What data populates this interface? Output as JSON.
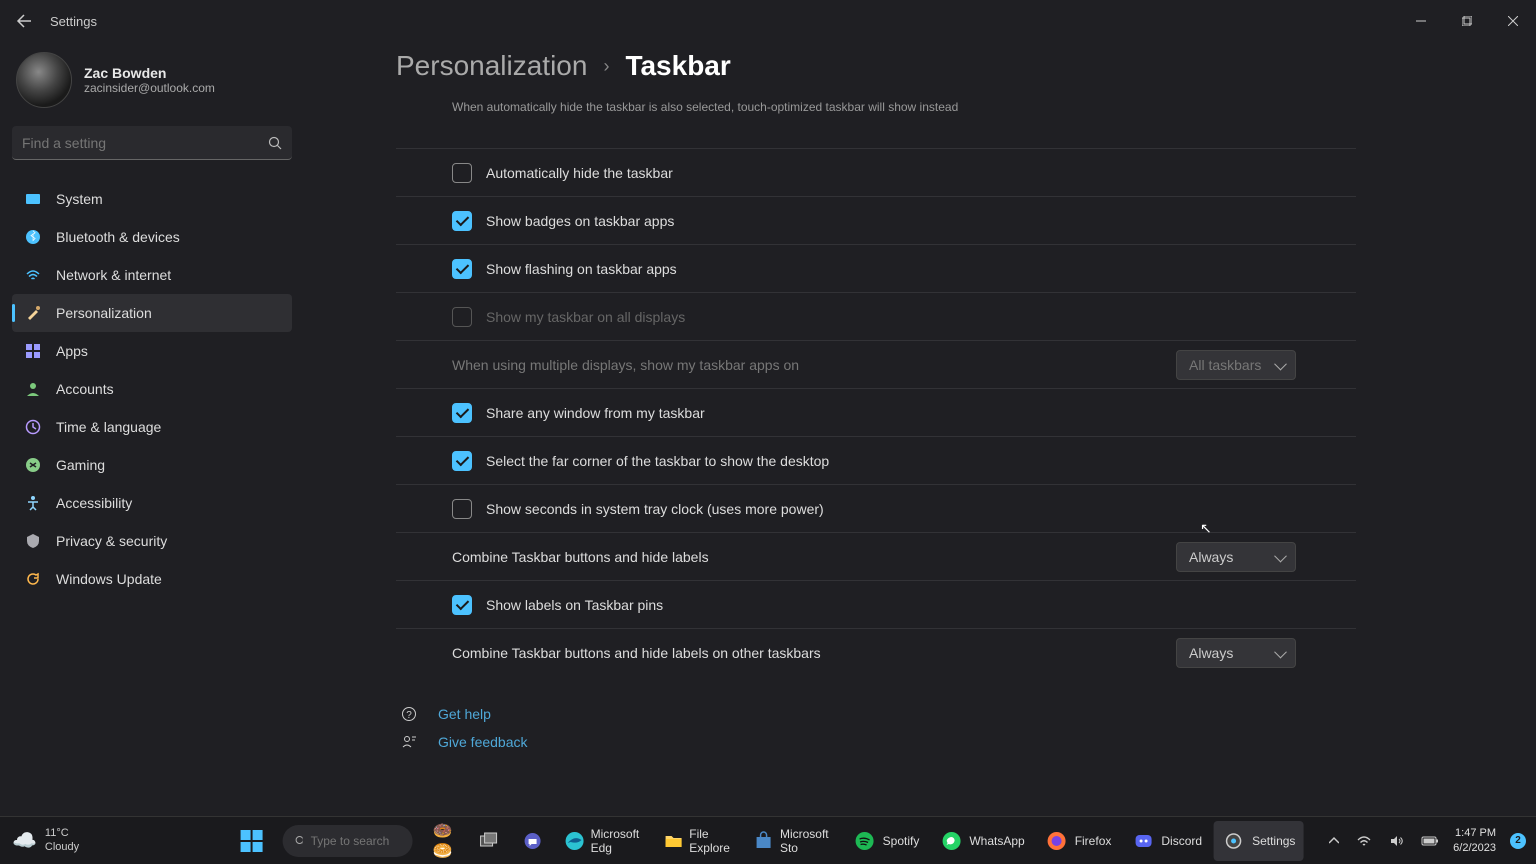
{
  "app": {
    "title": "Settings"
  },
  "window_controls": {
    "minimize": "−",
    "maximize": "▢",
    "close": "✕"
  },
  "user": {
    "name": "Zac Bowden",
    "email": "zacinsider@outlook.com"
  },
  "search": {
    "placeholder": "Find a setting"
  },
  "nav": [
    {
      "label": "System",
      "icon_color": "#4cc2ff",
      "active": false
    },
    {
      "label": "Bluetooth & devices",
      "icon_color": "#4cc2ff",
      "active": false
    },
    {
      "label": "Network & internet",
      "icon_color": "#4cc2ff",
      "active": false
    },
    {
      "label": "Personalization",
      "icon_color": "#f5d49a",
      "active": true
    },
    {
      "label": "Apps",
      "icon_color": "#9b9bff",
      "active": false
    },
    {
      "label": "Accounts",
      "icon_color": "#7cc97c",
      "active": false
    },
    {
      "label": "Time & language",
      "icon_color": "#b89bff",
      "active": false
    },
    {
      "label": "Gaming",
      "icon_color": "#88cc88",
      "active": false
    },
    {
      "label": "Accessibility",
      "icon_color": "#8fd6ff",
      "active": false
    },
    {
      "label": "Privacy & security",
      "icon_color": "#aaaab0",
      "active": false
    },
    {
      "label": "Windows Update",
      "icon_color": "#ffb84d",
      "active": false
    }
  ],
  "breadcrumb": {
    "parent": "Personalization",
    "current": "Taskbar"
  },
  "helper_text": "When automatically hide the taskbar is also selected, touch-optimized taskbar will show instead",
  "settings": {
    "auto_hide": {
      "label": "Automatically hide the taskbar",
      "checked": false
    },
    "badges": {
      "label": "Show badges on taskbar apps",
      "checked": true
    },
    "flashing": {
      "label": "Show flashing on taskbar apps",
      "checked": true
    },
    "all_displays": {
      "label": "Show my taskbar on all displays",
      "checked": false,
      "disabled": true
    },
    "multi_label": "When using multiple displays, show my taskbar apps on",
    "multi_value": "All taskbars",
    "share_window": {
      "label": "Share any window from my taskbar",
      "checked": true
    },
    "far_corner": {
      "label": "Select the far corner of the taskbar to show the desktop",
      "checked": true
    },
    "show_seconds": {
      "label": "Show seconds in system tray clock (uses more power)",
      "checked": false
    },
    "combine_label": "Combine Taskbar buttons and hide labels",
    "combine_value": "Always",
    "labels_pins": {
      "label": "Show labels on Taskbar pins",
      "checked": true
    },
    "combine_other_label": "Combine Taskbar buttons and hide labels on other taskbars",
    "combine_other_value": "Always"
  },
  "help": {
    "get_help": "Get help",
    "feedback": "Give feedback"
  },
  "taskbar": {
    "weather_temp": "11°C",
    "weather_desc": "Cloudy",
    "search_placeholder": "Type to search",
    "apps": [
      {
        "name": "Microsoft Edge",
        "short": "Microsoft Edg"
      },
      {
        "name": "File Explorer",
        "short": "File Explore"
      },
      {
        "name": "Microsoft Store",
        "short": "Microsoft Sto"
      },
      {
        "name": "Spotify",
        "short": "Spotify"
      },
      {
        "name": "WhatsApp",
        "short": "WhatsApp"
      },
      {
        "name": "Firefox",
        "short": "Firefox"
      },
      {
        "name": "Discord",
        "short": "Discord"
      },
      {
        "name": "Settings",
        "short": "Settings"
      }
    ],
    "time": "1:47 PM",
    "date": "6/2/2023",
    "notif_count": "2"
  }
}
